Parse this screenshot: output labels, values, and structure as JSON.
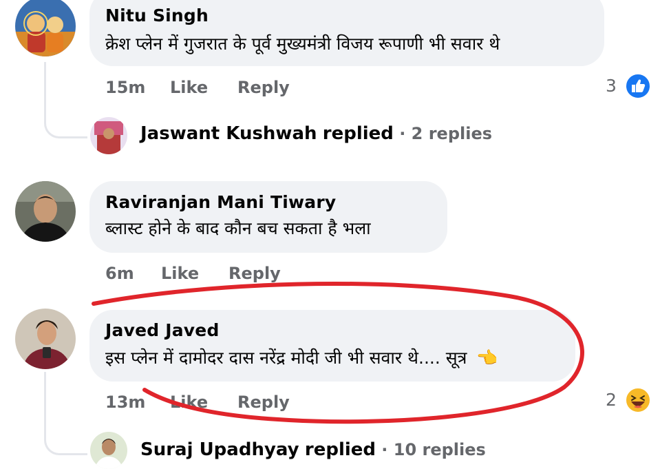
{
  "comments": [
    {
      "author": "Nitu Singh",
      "text": "क्रेश प्लेन में गुजरात के पूर्व मुख्यमंत्री विजय रूपाणी भी सवार थे",
      "time": "15m",
      "like": "Like",
      "reply": "Reply",
      "reaction_count": "3",
      "reaction": "like-reaction-icon",
      "replied": {
        "name": "Jaswant Kushwah",
        "verb": "replied",
        "count": "· 2 replies"
      }
    },
    {
      "author": "Raviranjan Mani Tiwary",
      "text": "ब्लास्ट होने के बाद कौन बच सकता है भला",
      "time": "6m",
      "like": "Like",
      "reply": "Reply"
    },
    {
      "author": "Javed Javed",
      "text": "इस प्लेन में दामोदर दास नरेंद्र मोदी जी भी सवार थे.... सूत्र",
      "emoji": "👈",
      "time": "13m",
      "like": "Like",
      "reply": "Reply",
      "reaction_count": "2",
      "reaction": "haha-reaction-icon",
      "replied": {
        "name": "Suraj Upadhyay",
        "verb": "replied",
        "count": "· 10 replies"
      }
    }
  ],
  "colors": {
    "bubble": "#f0f2f5",
    "meta_text": "#65676b",
    "like_blue": "#1877f2",
    "haha_yellow": "#f7b928",
    "annotation_red": "#e0252b"
  }
}
